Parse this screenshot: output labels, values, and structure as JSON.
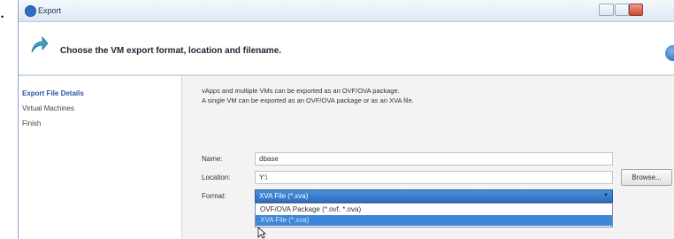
{
  "window": {
    "title": "Export",
    "bullet": "•"
  },
  "header": {
    "text": "Choose the VM export format, location and filename."
  },
  "nav": {
    "items": [
      {
        "label": "Export File Details",
        "active": true
      },
      {
        "label": "Virtual Machines",
        "active": false
      },
      {
        "label": "Finish",
        "active": false
      }
    ]
  },
  "description": {
    "line1": "vApps and multiple VMs can be exported as an OVF/OVA package.",
    "line2": "A single VM can be exported as an OVF/OVA package or as an XVA file."
  },
  "form": {
    "name_label": "Name:",
    "name_value": "dbase",
    "location_label": "Location:",
    "location_value": "Y:\\",
    "browse_label": "Browse...",
    "format_label": "Format:",
    "format_value": "XVA File (*.xva)",
    "format_options": [
      "OVF/OVA Package (*.ovf, *.ova)",
      "XVA File (*.xva)"
    ]
  },
  "colors": {
    "accent": "#3e86d8",
    "active_nav": "#2a56a3"
  },
  "icons": [
    "export-app-icon",
    "export-arrow-icon",
    "globe-icon",
    "dropdown-arrow-icon",
    "mouse-cursor-icon"
  ]
}
